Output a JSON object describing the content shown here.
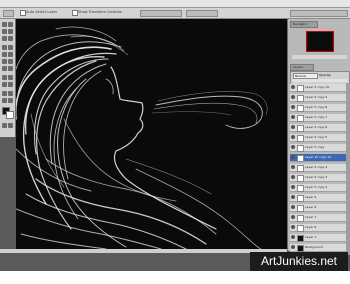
{
  "options_bar": {
    "auto_select_label": "Auto-Select Layer",
    "transform_label": "Show Transform Controls"
  },
  "panels": {
    "navigator_tab": "Navigator",
    "layers_tab": "Layers",
    "blend_mode": "Normal",
    "opacity_label": "Opacity:"
  },
  "layers": [
    {
      "name": "Layer 5 copy 10"
    },
    {
      "name": "Layer 5 copy 9"
    },
    {
      "name": "Layer 5 copy 8"
    },
    {
      "name": "Layer 5 copy 7"
    },
    {
      "name": "Layer 5 copy 6"
    },
    {
      "name": "Layer 5 copy 5"
    },
    {
      "name": "Layer 5 copy"
    },
    {
      "name": "Layer 15 copy 14"
    },
    {
      "name": "Layer 5 copy 4"
    },
    {
      "name": "Layer 5 copy 3"
    },
    {
      "name": "Layer 5 copy 2"
    },
    {
      "name": "Layer 9"
    },
    {
      "name": "Layer 8"
    },
    {
      "name": "Layer 7"
    },
    {
      "name": "Layer 6"
    },
    {
      "name": "Layer 1"
    },
    {
      "name": "Background"
    }
  ],
  "watermark": "ArtJunkies.net",
  "colors": {
    "canvas_bg": "#0a0a0a",
    "selected_layer": "#3d68b5",
    "hair_stroke": "#e8e8e8"
  }
}
